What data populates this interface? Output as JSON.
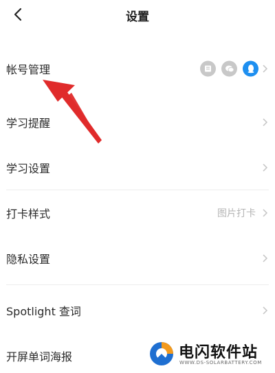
{
  "header": {
    "title": "设置",
    "back_icon": "chevron-left-icon"
  },
  "rows": [
    {
      "label": "帐号管理",
      "value": "",
      "accounts": [
        "book-icon",
        "chat-bubble-icon",
        "qq-penguin-icon"
      ]
    },
    {
      "label": "学习提醒",
      "value": ""
    },
    {
      "label": "学习设置",
      "value": ""
    },
    {
      "label": "打卡样式",
      "value": "图片打卡"
    },
    {
      "label": "隐私设置",
      "value": ""
    },
    {
      "label": "Spotlight 查词",
      "value": ""
    },
    {
      "label": "开屏单词海报",
      "value": ""
    }
  ],
  "annotation": {
    "color": "#e02b2b",
    "icon": "red-arrow-icon"
  },
  "watermark": {
    "name": "电闪软件站",
    "url": "WWW.DS-SOLARBATTERY.COM",
    "colors": {
      "blue": "#1f6fd1",
      "orange": "#f39a1e"
    }
  },
  "colors": {
    "accent_blue": "#1e8ff0",
    "muted": "#b5b5b5",
    "divider": "#ececec"
  }
}
